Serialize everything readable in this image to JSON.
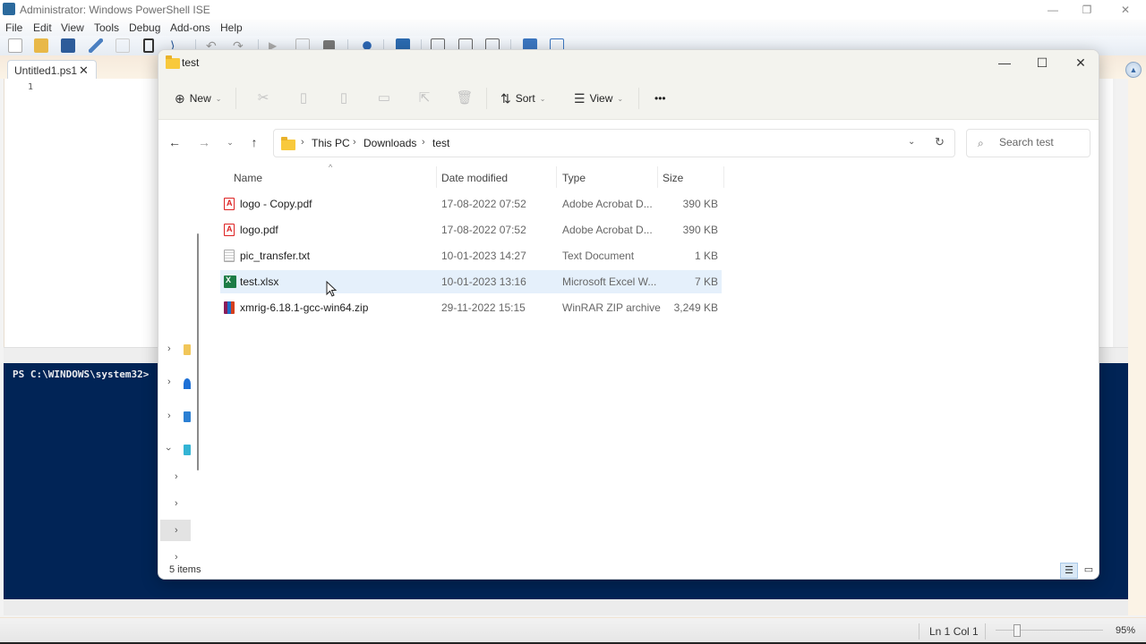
{
  "ise": {
    "title": "Administrator: Windows PowerShell ISE",
    "menu": [
      "File",
      "Edit",
      "View",
      "Tools",
      "Debug",
      "Add-ons",
      "Help"
    ],
    "toolbar_icons": [
      "new-file-icon",
      "open-file-icon",
      "save-icon",
      "cut-icon",
      "copy-icon",
      "paste-icon",
      "powershell-icon",
      "undo-icon",
      "redo-icon",
      "run-script-icon",
      "run-selection-icon",
      "stop-icon",
      "remote-powershell-icon",
      "start-powershell-icon",
      "show-script-pane-top-icon",
      "show-script-pane-right-icon",
      "show-script-pane-max-icon",
      "show-commands-icon",
      "show-command-addon-icon"
    ],
    "tab": {
      "label": "Untitled1.ps1",
      "close": "✕"
    },
    "line_number": "1",
    "console_prompt": "PS C:\\WINDOWS\\system32>",
    "status": {
      "position": "Ln 1  Col 1",
      "zoom": "95%"
    },
    "zoom_percent": 95
  },
  "explorer": {
    "title": "test",
    "commands": {
      "new": "New",
      "sort": "Sort",
      "view": "View",
      "more": "•••"
    },
    "breadcrumb": [
      "This PC",
      "Downloads",
      "test"
    ],
    "search_placeholder": "Search test",
    "columns": {
      "name": "Name",
      "date": "Date modified",
      "type": "Type",
      "size": "Size"
    },
    "files": [
      {
        "name": "logo - Copy.pdf",
        "date": "17-08-2022 07:52",
        "type": "Adobe Acrobat D...",
        "size": "390 KB",
        "icon": "pdf"
      },
      {
        "name": "logo.pdf",
        "date": "17-08-2022 07:52",
        "type": "Adobe Acrobat D...",
        "size": "390 KB",
        "icon": "pdf"
      },
      {
        "name": "pic_transfer.txt",
        "date": "10-01-2023 14:27",
        "type": "Text Document",
        "size": "1 KB",
        "icon": "txt"
      },
      {
        "name": "test.xlsx",
        "date": "10-01-2023 13:16",
        "type": "Microsoft Excel W...",
        "size": "7 KB",
        "icon": "xlsx"
      },
      {
        "name": "xmrig-6.18.1-gcc-win64.zip",
        "date": "29-11-2022 15:15",
        "type": "WinRAR ZIP archive",
        "size": "3,249 KB",
        "icon": "zip"
      }
    ],
    "status_count": "5 items"
  }
}
